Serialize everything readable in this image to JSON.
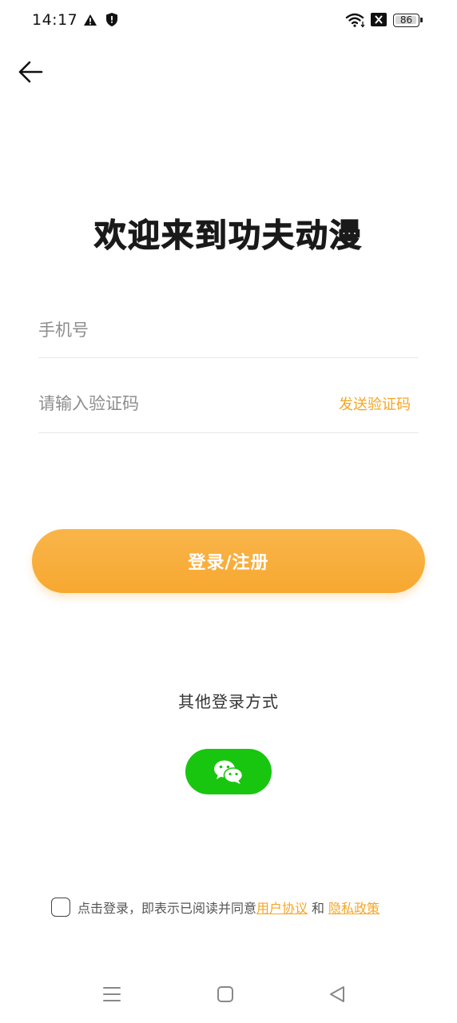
{
  "status_bar": {
    "time": "14:17",
    "battery_level": "86",
    "icons": [
      "warning-icon",
      "shield-icon",
      "wifi-icon",
      "sim-off-icon",
      "battery-icon"
    ]
  },
  "nav": {
    "back_icon": "arrow-left-icon"
  },
  "title": "欢迎来到功夫动漫",
  "form": {
    "phone_placeholder": "手机号",
    "phone_value": "",
    "code_placeholder": "请输入验证码",
    "code_value": "",
    "send_code_label": "发送验证码"
  },
  "login_button_label": "登录/注册",
  "other_login": {
    "label": "其他登录方式",
    "wechat_icon": "wechat-icon"
  },
  "agreement": {
    "checked": false,
    "text": "点击登录，即表示已阅读并同意",
    "user_agreement": "用户协议",
    "and": "和",
    "privacy_policy": "隐私政策"
  },
  "system_nav": {
    "icons": [
      "menu-icon",
      "home-icon",
      "back-triangle-icon"
    ]
  },
  "colors": {
    "accent": "#f5a623",
    "button_gradient_top": "#f9b54a",
    "button_gradient_bottom": "#f7a830",
    "wechat_green": "#19c60f",
    "title": "#1a1a1a",
    "divider": "#e9e9e9"
  }
}
